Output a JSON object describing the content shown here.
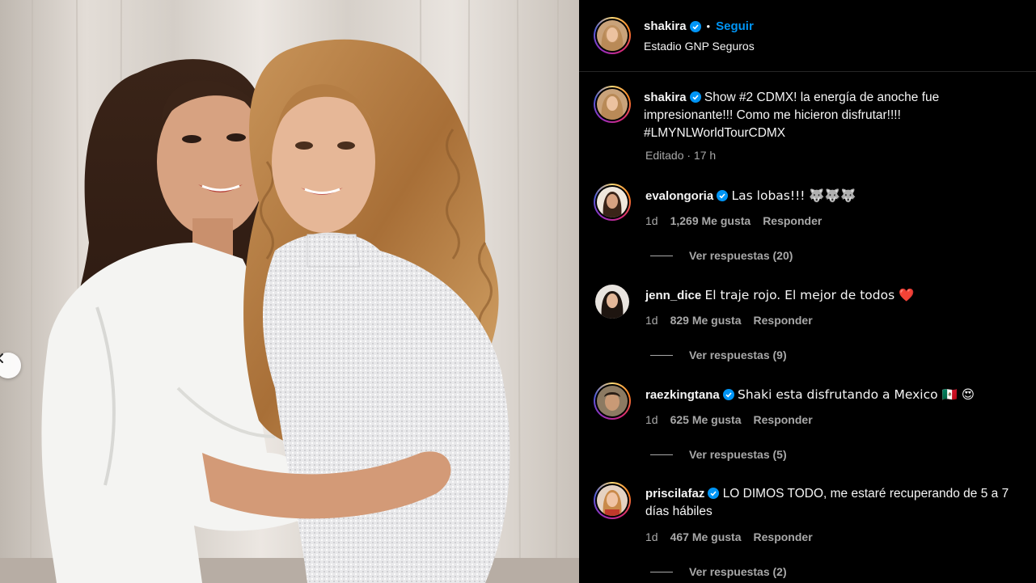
{
  "header": {
    "username": "shakira",
    "follow_label": "Seguir",
    "separator": "•",
    "location": "Estadio GNP Seguros"
  },
  "caption": {
    "username": "shakira",
    "text": "Show #2 CDMX! la energía de anoche fue impresionante!!! Como me hicieron disfrutar!!!! ",
    "hashtag": "#LMYNLWorldTourCDMX",
    "meta": "Editado · 17 h"
  },
  "comments": [
    {
      "username": "evalongoria",
      "text": "Las lobas!!! 🐺🐺🐺",
      "time": "1d",
      "likes": "1,269 Me gusta",
      "reply_label": "Responder",
      "view_replies": "Ver respuestas (20)"
    },
    {
      "username": "jenn_dice",
      "text": "El traje rojo. El mejor de todos ❤️",
      "time": "1d",
      "likes": "829 Me gusta",
      "reply_label": "Responder",
      "view_replies": "Ver respuestas (9)"
    },
    {
      "username": "raezkingtana",
      "text": "Shaki esta disfrutando a Mexico 🇲🇽 😍",
      "time": "1d",
      "likes": "625 Me gusta",
      "reply_label": "Responder",
      "view_replies": "Ver respuestas (5)"
    },
    {
      "username": "priscilafaz",
      "text": "LO DIMOS TODO, me estaré recuperando de 5 a 7 días hábiles",
      "time": "1d",
      "likes": "467 Me gusta",
      "reply_label": "Responder",
      "view_replies": "Ver respuestas (2)"
    }
  ],
  "colors": {
    "background": "#000000",
    "text": "#f5f5f5",
    "secondary": "#a8a8a8",
    "accent": "#0095f6"
  },
  "icons": {
    "verified": "verified-badge-icon",
    "prev": "chevron-left-icon"
  }
}
